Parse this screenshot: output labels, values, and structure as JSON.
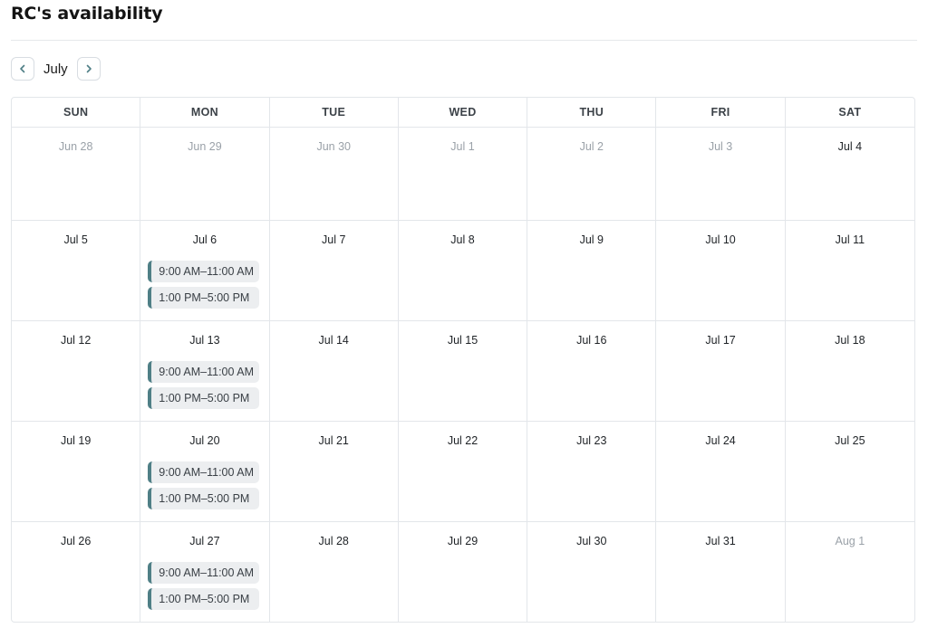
{
  "page": {
    "title": "RC's availability"
  },
  "nav": {
    "month": "July",
    "prev_icon": "chevron-left-icon",
    "next_icon": "chevron-right-icon",
    "accent": "#4f7f86"
  },
  "calendar": {
    "weekdays": [
      "SUN",
      "MON",
      "TUE",
      "WED",
      "THU",
      "FRI",
      "SAT"
    ],
    "weeks": [
      [
        {
          "label": "Jun 28",
          "muted": true,
          "slots": []
        },
        {
          "label": "Jun 29",
          "muted": true,
          "slots": []
        },
        {
          "label": "Jun 30",
          "muted": true,
          "slots": []
        },
        {
          "label": "Jul 1",
          "muted": true,
          "slots": []
        },
        {
          "label": "Jul 2",
          "muted": true,
          "slots": []
        },
        {
          "label": "Jul 3",
          "muted": true,
          "slots": []
        },
        {
          "label": "Jul 4",
          "muted": false,
          "slots": []
        }
      ],
      [
        {
          "label": "Jul 5",
          "muted": false,
          "slots": []
        },
        {
          "label": "Jul 6",
          "muted": false,
          "slots": [
            "9:00 AM–11:00 AM",
            "1:00 PM–5:00 PM"
          ]
        },
        {
          "label": "Jul 7",
          "muted": false,
          "slots": []
        },
        {
          "label": "Jul 8",
          "muted": false,
          "slots": []
        },
        {
          "label": "Jul 9",
          "muted": false,
          "slots": []
        },
        {
          "label": "Jul 10",
          "muted": false,
          "slots": []
        },
        {
          "label": "Jul 11",
          "muted": false,
          "slots": []
        }
      ],
      [
        {
          "label": "Jul 12",
          "muted": false,
          "slots": []
        },
        {
          "label": "Jul 13",
          "muted": false,
          "slots": [
            "9:00 AM–11:00 AM",
            "1:00 PM–5:00 PM"
          ]
        },
        {
          "label": "Jul 14",
          "muted": false,
          "slots": []
        },
        {
          "label": "Jul 15",
          "muted": false,
          "slots": []
        },
        {
          "label": "Jul 16",
          "muted": false,
          "slots": []
        },
        {
          "label": "Jul 17",
          "muted": false,
          "slots": []
        },
        {
          "label": "Jul 18",
          "muted": false,
          "slots": []
        }
      ],
      [
        {
          "label": "Jul 19",
          "muted": false,
          "slots": []
        },
        {
          "label": "Jul 20",
          "muted": false,
          "slots": [
            "9:00 AM–11:00 AM",
            "1:00 PM–5:00 PM"
          ]
        },
        {
          "label": "Jul 21",
          "muted": false,
          "slots": []
        },
        {
          "label": "Jul 22",
          "muted": false,
          "slots": []
        },
        {
          "label": "Jul 23",
          "muted": false,
          "slots": []
        },
        {
          "label": "Jul 24",
          "muted": false,
          "slots": []
        },
        {
          "label": "Jul 25",
          "muted": false,
          "slots": []
        }
      ],
      [
        {
          "label": "Jul 26",
          "muted": false,
          "slots": []
        },
        {
          "label": "Jul 27",
          "muted": false,
          "slots": [
            "9:00 AM–11:00 AM",
            "1:00 PM–5:00 PM"
          ]
        },
        {
          "label": "Jul 28",
          "muted": false,
          "slots": []
        },
        {
          "label": "Jul 29",
          "muted": false,
          "slots": []
        },
        {
          "label": "Jul 30",
          "muted": false,
          "slots": []
        },
        {
          "label": "Jul 31",
          "muted": false,
          "slots": []
        },
        {
          "label": "Aug 1",
          "muted": true,
          "slots": []
        }
      ]
    ]
  }
}
